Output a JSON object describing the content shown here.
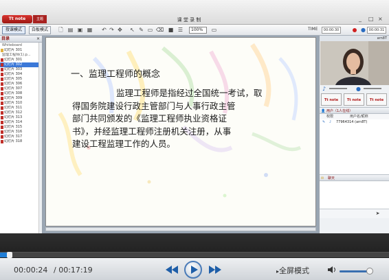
{
  "window": {
    "logo_text": "Tt note",
    "logo_sub": "主题",
    "title": "课 堂 录 制",
    "controls": [
      "_",
      "□",
      "×"
    ]
  },
  "toolbar": {
    "mode_button": "授课模式",
    "whiteboard_button": "白板模式",
    "zoom_value": "100%",
    "time_label": "TIME",
    "time_elapsed": "00:00:30",
    "time_total": "00:00:31"
  },
  "left_panel": {
    "title": "目录",
    "items": [
      {
        "label": "Whiteboard",
        "type": "wb"
      },
      {
        "label": "幻灯片 301",
        "type": "root"
      },
      {
        "label": "监理工程师(1).p...",
        "type": "wb"
      },
      {
        "label": "幻灯片 301",
        "type": "slide"
      },
      {
        "label": "幻灯片 302",
        "type": "slide",
        "selected": true
      },
      {
        "label": "幻灯片 303",
        "type": "slide"
      },
      {
        "label": "幻灯片 304",
        "type": "slide"
      },
      {
        "label": "幻灯片 305",
        "type": "slide"
      },
      {
        "label": "幻灯片 306",
        "type": "slide"
      },
      {
        "label": "幻灯片 307",
        "type": "slide"
      },
      {
        "label": "幻灯片 308",
        "type": "slide"
      },
      {
        "label": "幻灯片 309",
        "type": "slide"
      },
      {
        "label": "幻灯片 310",
        "type": "slide"
      },
      {
        "label": "幻灯片 311",
        "type": "slide"
      },
      {
        "label": "幻灯片 312",
        "type": "slide"
      },
      {
        "label": "幻灯片 313",
        "type": "slide"
      },
      {
        "label": "幻灯片 314",
        "type": "slide"
      },
      {
        "label": "幻灯片 315",
        "type": "slide"
      },
      {
        "label": "幻灯片 316",
        "type": "slide"
      },
      {
        "label": "幻灯片 317",
        "type": "slide"
      },
      {
        "label": "幻灯片 318",
        "type": "slide"
      }
    ]
  },
  "slide": {
    "heading": "一、监理工程师的概念",
    "body_lines": [
      "监理工程师是指经过全国统一考试，取",
      "得国务院建设行政主管部门与人事行政主管",
      "部门共同颁发的《监理工程师执业资格证",
      "书》，并经监理工程师注册机关注册，从事",
      "建设工程监理工作的人员。"
    ]
  },
  "right_panel": {
    "video_header": "arn8T",
    "cam_labels": [
      "Tt note",
      "Tt note",
      "Tt note"
    ],
    "users_title": "用户（1人在线）",
    "users_columns": [
      "权限",
      "用户名/昵称"
    ],
    "users": [
      {
        "name": "77964314 (arn8T)"
      }
    ],
    "chat_title": "聊天"
  },
  "player": {
    "current_time": "00:00:24",
    "total_time": "/ 00:17:19",
    "fullscreen_label": "全屏模式",
    "progress_fraction": 0.024,
    "volume_fraction": 0.85
  }
}
